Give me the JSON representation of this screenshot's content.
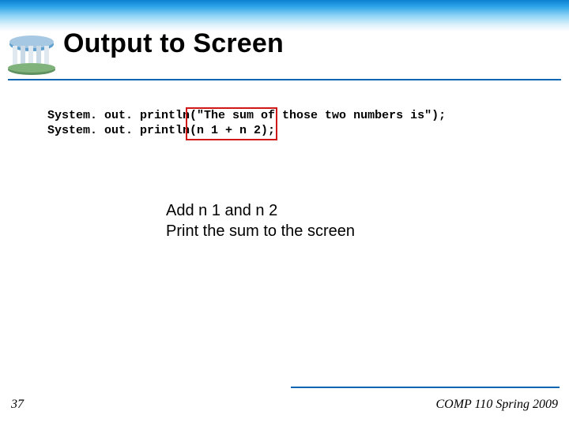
{
  "header": {
    "title": "Output to Screen"
  },
  "code": {
    "line1": "System. out. println(\"The sum of those two numbers is\");",
    "line2": "System. out. println(n 1 + n 2);"
  },
  "caption": {
    "line1": "Add n 1 and n 2",
    "line2": "Print the sum to the screen"
  },
  "footer": {
    "slide_number": "37",
    "course": "COMP 110 Spring 2009"
  }
}
